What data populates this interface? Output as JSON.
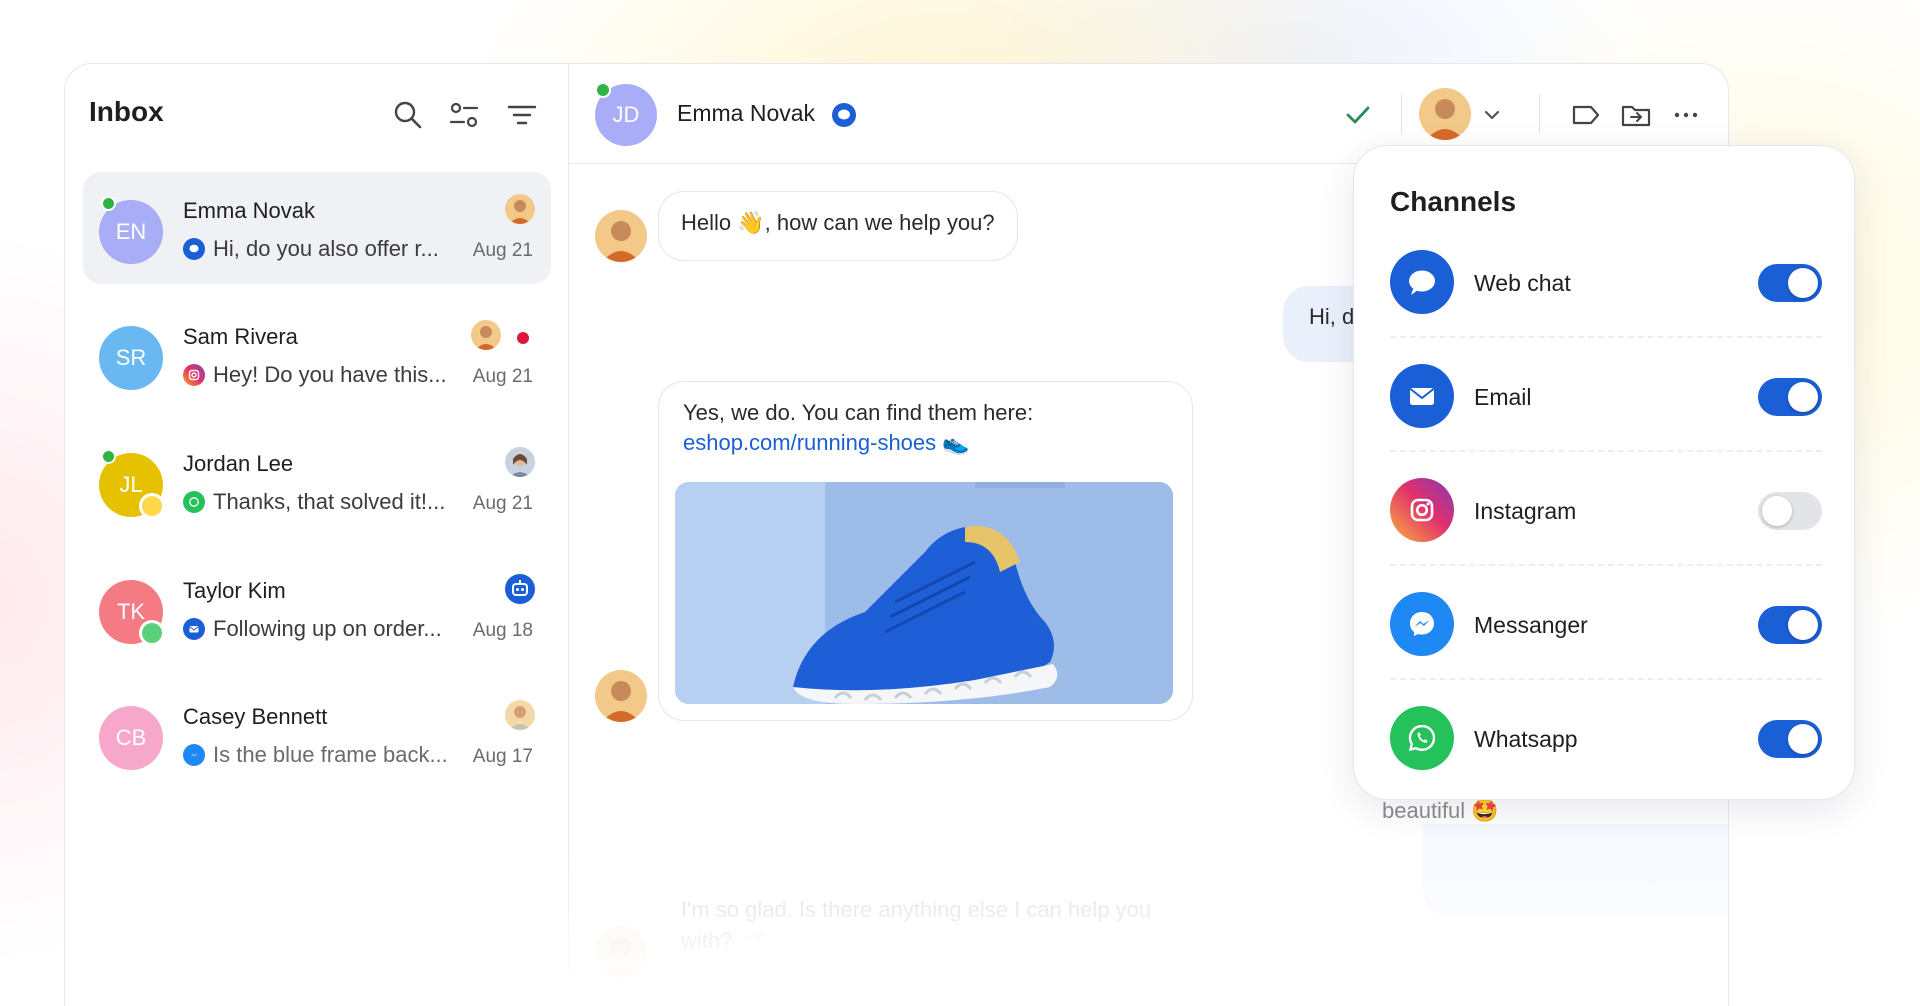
{
  "inbox": {
    "title": "Inbox",
    "conversations": [
      {
        "name": "Emma Novak",
        "initials": "EN",
        "color": "#a9acf7",
        "preview": "Hi, do you also offer r...",
        "date": "Aug 21",
        "channel": "Web chat",
        "online": true
      },
      {
        "name": "Sam Rivera",
        "initials": "SR",
        "color": "#6ab8f2",
        "preview": "Hey! Do you have this...",
        "date": "Aug 21",
        "channel": "Instagram",
        "unread": true
      },
      {
        "name": "Jordan Lee",
        "initials": "JL",
        "color": "#e5c100",
        "preview": "Thanks, that solved it!...",
        "date": "Aug 21",
        "channel": "Whatsapp",
        "online": true
      },
      {
        "name": "Taylor Kim",
        "initials": "TK",
        "color": "#f47a84",
        "preview": "Following up on order...",
        "date": "Aug 18",
        "channel": "Email"
      },
      {
        "name": "Casey Bennett",
        "initials": "CB",
        "color": "#f7a7c9",
        "preview": "Is the blue frame back...",
        "date": "Aug 17",
        "channel": "Messanger"
      }
    ]
  },
  "chat": {
    "contact_name": "Emma Novak",
    "contact_initials": "JD",
    "messages": {
      "agent_greeting": "Hello 👋, how can we help you?",
      "customer_partial": "Hi, d",
      "agent_reply_line1": "Yes, we do. You can find them here:",
      "agent_reply_link": "eshop.com/running-shoes",
      "agent_reply_emoji": "👟",
      "faded_customer": "beautiful 🤩",
      "faded_agent": "I'm so glad. Is there anything else I can help you with? 🥂"
    }
  },
  "channels": {
    "title": "Channels",
    "items": [
      {
        "label": "Web chat",
        "enabled": true,
        "icon": "web-chat-icon",
        "color": "#1a5fd6"
      },
      {
        "label": "Email",
        "enabled": true,
        "icon": "email-icon",
        "color": "#1a5fd6"
      },
      {
        "label": "Instagram",
        "enabled": false,
        "icon": "instagram-icon",
        "color": "#e1306c"
      },
      {
        "label": "Messanger",
        "enabled": true,
        "icon": "messenger-icon",
        "color": "#1e88f5"
      },
      {
        "label": "Whatsapp",
        "enabled": true,
        "icon": "whatsapp-icon",
        "color": "#25c15a"
      }
    ]
  }
}
